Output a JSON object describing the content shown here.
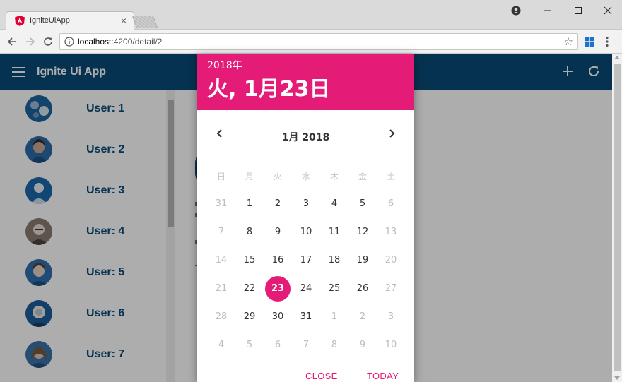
{
  "browser": {
    "tab_title": "IgniteUiApp",
    "tab_close": "×",
    "url_host": "localhost",
    "url_path": ":4200/detail/2",
    "colors": {
      "accent": "#e41c77",
      "brand": "#0a4b78"
    }
  },
  "app": {
    "title": "Ignite Ui App",
    "users": [
      {
        "label": "User: 1"
      },
      {
        "label": "User: 2"
      },
      {
        "label": "User: 3"
      },
      {
        "label": "User: 4"
      },
      {
        "label": "User: 5"
      },
      {
        "label": "User: 6"
      },
      {
        "label": "User: 7"
      }
    ]
  },
  "datepicker": {
    "year": "2018年",
    "selected_date": "火, 1月23日",
    "month_label": "1月 2018",
    "weekdays": [
      "日",
      "月",
      "火",
      "水",
      "木",
      "金",
      "土"
    ],
    "weeks": [
      [
        {
          "d": "31",
          "muted": true
        },
        {
          "d": "1"
        },
        {
          "d": "2"
        },
        {
          "d": "3"
        },
        {
          "d": "4"
        },
        {
          "d": "5"
        },
        {
          "d": "6",
          "muted": true
        }
      ],
      [
        {
          "d": "7",
          "muted": true
        },
        {
          "d": "8"
        },
        {
          "d": "9"
        },
        {
          "d": "10"
        },
        {
          "d": "11"
        },
        {
          "d": "12"
        },
        {
          "d": "13",
          "muted": true
        }
      ],
      [
        {
          "d": "14",
          "muted": true
        },
        {
          "d": "15"
        },
        {
          "d": "16"
        },
        {
          "d": "17"
        },
        {
          "d": "18"
        },
        {
          "d": "19"
        },
        {
          "d": "20",
          "muted": true
        }
      ],
      [
        {
          "d": "21",
          "muted": true
        },
        {
          "d": "22"
        },
        {
          "d": "23",
          "selected": true
        },
        {
          "d": "24"
        },
        {
          "d": "25"
        },
        {
          "d": "26"
        },
        {
          "d": "27",
          "muted": true
        }
      ],
      [
        {
          "d": "28",
          "muted": true
        },
        {
          "d": "29"
        },
        {
          "d": "30"
        },
        {
          "d": "31"
        },
        {
          "d": "1",
          "muted": true
        },
        {
          "d": "2",
          "muted": true
        },
        {
          "d": "3",
          "muted": true
        }
      ],
      [
        {
          "d": "4",
          "muted": true
        },
        {
          "d": "5",
          "muted": true
        },
        {
          "d": "6",
          "muted": true
        },
        {
          "d": "7",
          "muted": true
        },
        {
          "d": "8",
          "muted": true
        },
        {
          "d": "9",
          "muted": true
        },
        {
          "d": "10",
          "muted": true
        }
      ]
    ],
    "close_label": "CLOSE",
    "today_label": "TODAY"
  }
}
